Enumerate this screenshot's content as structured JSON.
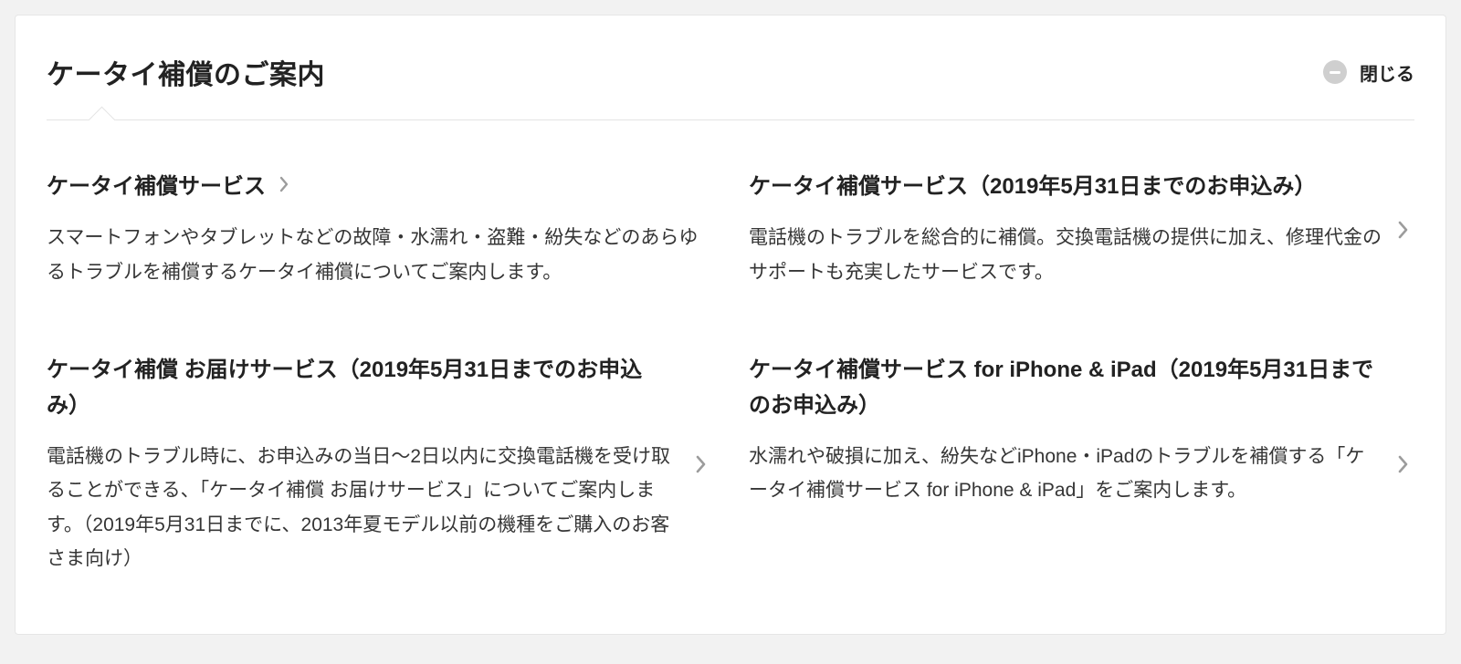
{
  "title": "ケータイ補償のご案内",
  "close_label": "閉じる",
  "items": [
    {
      "title": "ケータイ補償サービス",
      "desc": "スマートフォンやタブレットなどの故障・水濡れ・盗難・紛失などのあらゆるトラブルを補償するケータイ補償についてご案内します。"
    },
    {
      "title": "ケータイ補償サービス（2019年5月31日までのお申込み）",
      "desc": "電話機のトラブルを総合的に補償。交換電話機の提供に加え、修理代金のサポートも充実したサービスです。"
    },
    {
      "title": "ケータイ補償 お届けサービス（2019年5月31日までのお申込み）",
      "desc": "電話機のトラブル時に、お申込みの当日〜2日以内に交換電話機を受け取ることができる、「ケータイ補償 お届けサービス」についてご案内します。（2019年5月31日までに、2013年夏モデル以前の機種をご購入のお客さま向け）"
    },
    {
      "title": "ケータイ補償サービス for iPhone & iPad（2019年5月31日までのお申込み）",
      "desc": "水濡れや破損に加え、紛失などiPhone・iPadのトラブルを補償する「ケータイ補償サービス for iPhone & iPad」をご案内します。"
    }
  ]
}
